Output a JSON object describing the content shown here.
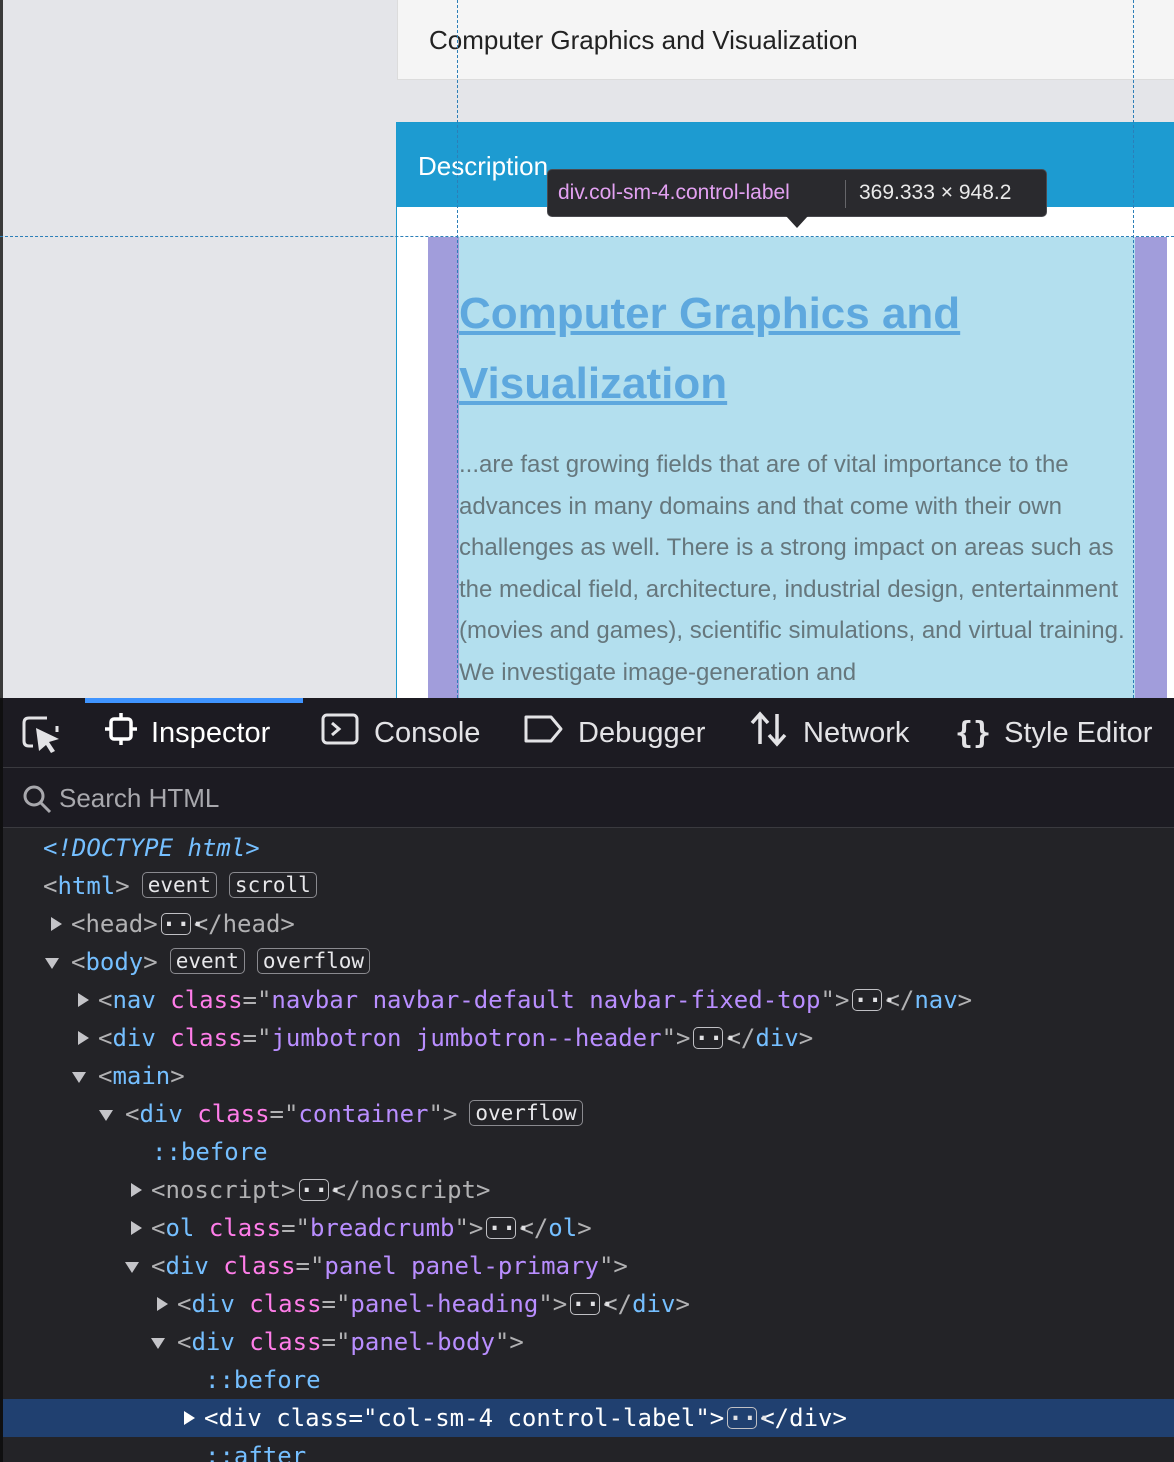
{
  "page": {
    "title_card_text": "Computer Graphics and Visualization",
    "panel_heading": "Description",
    "content_heading": "Computer Graphics and Visualization",
    "content_paragraph": "...are fast growing fields that are of vital importance to the advances in many domains and that come with their own challenges as well. There is a strong impact on areas such as the medical field, architecture, industrial design, entertainment (movies and games), scientific simulations, and virtual training. We investigate image-generation and",
    "highlight_color": "#b3dfee",
    "padding_color": "#a19ddb"
  },
  "tooltip": {
    "selector": "div.col-sm-4.control-label",
    "dimensions": "369.333 × 948.2"
  },
  "devtools": {
    "tabs": {
      "inspector": "Inspector",
      "console": "Console",
      "debugger": "Debugger",
      "network": "Network",
      "style_editor": "Style Editor"
    },
    "active_tab": "Inspector",
    "accent_color": "#3f94ff",
    "search_placeholder": "Search HTML",
    "badges": {
      "event": "event",
      "scroll": "scroll",
      "overflow": "overflow"
    },
    "tree": {
      "doctype": "<!DOCTYPE html>",
      "html": "html",
      "head": "head",
      "body": "body",
      "nav": "nav",
      "nav_class": "navbar navbar-default navbar-fixed-top",
      "div": "div",
      "jumbotron_class": "jumbotron jumbotron--header",
      "main": "main",
      "container_class": "container",
      "before": "::before",
      "after": "::after",
      "noscript": "noscript",
      "ol": "ol",
      "breadcrumb_class": "breadcrumb",
      "panel_class": "panel panel-primary",
      "panel_heading_class": "panel-heading",
      "panel_body_class": "panel-body",
      "selected_class": "col-sm-4 control-label",
      "attr_class": "class"
    }
  }
}
